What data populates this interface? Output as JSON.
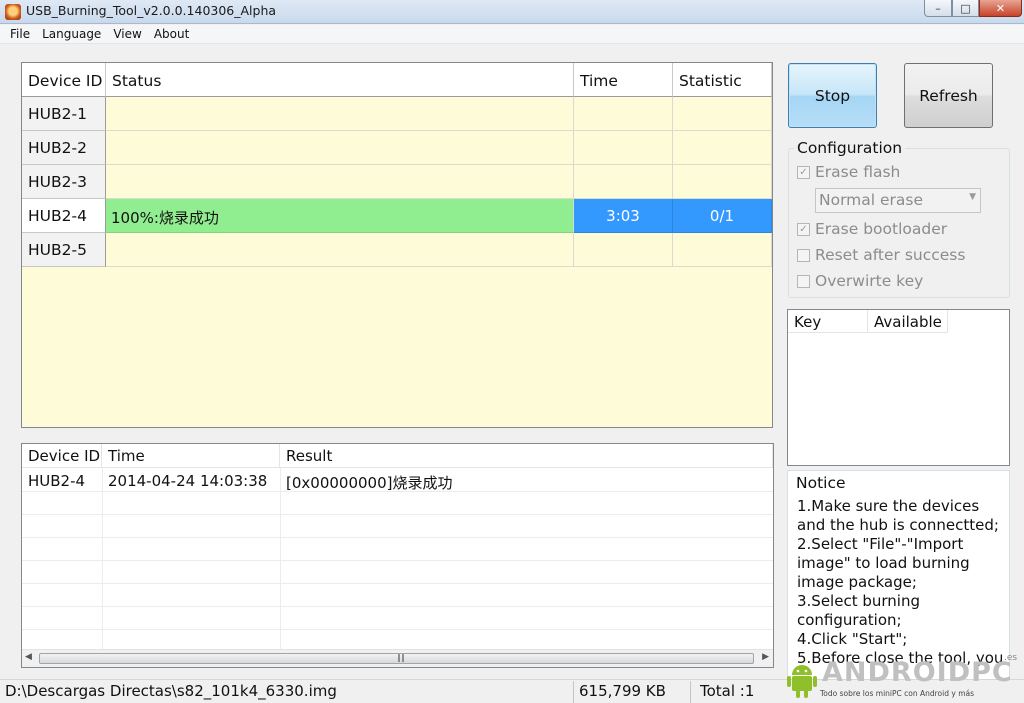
{
  "window": {
    "title": "USB_Burning_Tool_v2.0.0.140306_Alpha"
  },
  "menu": [
    "File",
    "Language",
    "View",
    "About"
  ],
  "device_grid": {
    "headers": {
      "device_id": "Device ID",
      "status": "Status",
      "time": "Time",
      "statistic": "Statistic"
    },
    "rows": [
      {
        "id": "HUB2-1",
        "status": "",
        "time": "",
        "statistic": ""
      },
      {
        "id": "HUB2-2",
        "status": "",
        "time": "",
        "statistic": ""
      },
      {
        "id": "HUB2-3",
        "status": "",
        "time": "",
        "statistic": ""
      },
      {
        "id": "HUB2-4",
        "status": "100%:烧录成功",
        "time": "3:03",
        "statistic": "0/1",
        "progress": 1.0
      },
      {
        "id": "HUB2-5",
        "status": "",
        "time": "",
        "statistic": ""
      }
    ]
  },
  "buttons": {
    "stop": "Stop",
    "refresh": "Refresh"
  },
  "configuration": {
    "title": "Configuration",
    "erase_flash": {
      "label": "Erase flash",
      "checked": true
    },
    "erase_mode": "Normal erase",
    "erase_bootloader": {
      "label": "Erase bootloader",
      "checked": true
    },
    "reset_after_success": {
      "label": "Reset after success",
      "checked": false
    },
    "overwrite_key": {
      "label": "Overwirte key",
      "checked": false
    }
  },
  "key_table": {
    "headers": [
      "Key",
      "Available"
    ]
  },
  "notice": {
    "title": "Notice",
    "lines": [
      "1.Make sure the devices",
      "and the hub is connectted;",
      "2.Select \"File\"-\"Import",
      "image\" to load burning",
      "image package;",
      "3.Select burning",
      "configuration;",
      "4.Click \"Start\";",
      "5.Before close the tool, you"
    ]
  },
  "log_table": {
    "headers": {
      "device_id": "Device ID",
      "time": "Time",
      "result": "Result"
    },
    "rows": [
      {
        "device_id": "HUB2-4",
        "time": "2014-04-24 14:03:38",
        "result": "[0x00000000]烧录成功"
      }
    ]
  },
  "status_bar": {
    "path": "D:\\Descargas Directas\\s82_101k4_6330.img",
    "size": "615,799 KB",
    "total": "Total :1"
  },
  "watermark": {
    "brand": "ANDROIDPC",
    "tld": ".es",
    "tagline": "Todo sobre los miniPC con Android y más"
  },
  "colors": {
    "grid_bg": "#fdfbd8",
    "success_green": "#90ee90",
    "selected_blue": "#3399ff",
    "stop_button_blue": "#a5d6f5"
  }
}
